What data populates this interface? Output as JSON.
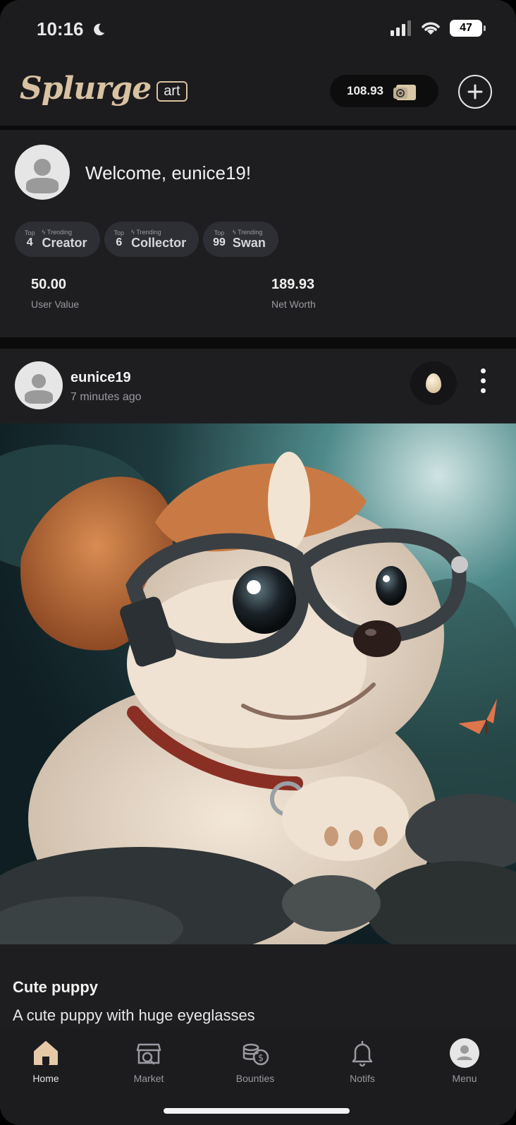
{
  "status_bar": {
    "time": "10:16",
    "battery": "47"
  },
  "header": {
    "logo_text": "Splurge",
    "logo_badge": "art",
    "wallet_balance": "108.93"
  },
  "profile": {
    "welcome": "Welcome, eunice19!",
    "badges": [
      {
        "top": "Top",
        "rank": "4",
        "trend": "Trending",
        "label": "Creator"
      },
      {
        "top": "Top",
        "rank": "6",
        "trend": "Trending",
        "label": "Collector"
      },
      {
        "top": "Top",
        "rank": "99",
        "trend": "Trending",
        "label": "Swan"
      }
    ],
    "stats": [
      {
        "value": "50.00",
        "label": "User Value"
      },
      {
        "value": "189.93",
        "label": "Net Worth"
      }
    ]
  },
  "post": {
    "username": "eunice19",
    "time": "7 minutes ago",
    "title": "Cute puppy",
    "description": "A cute puppy with huge eyeglasses"
  },
  "tabs": [
    {
      "label": "Home",
      "icon": "home-icon"
    },
    {
      "label": "Market",
      "icon": "market-icon"
    },
    {
      "label": "Bounties",
      "icon": "bounties-icon"
    },
    {
      "label": "Notifs",
      "icon": "bell-icon"
    },
    {
      "label": "Menu",
      "icon": "avatar-icon"
    }
  ],
  "colors": {
    "accent": "#d8c2a2",
    "background": "#1c1c1e",
    "card": "#1e1e20"
  }
}
